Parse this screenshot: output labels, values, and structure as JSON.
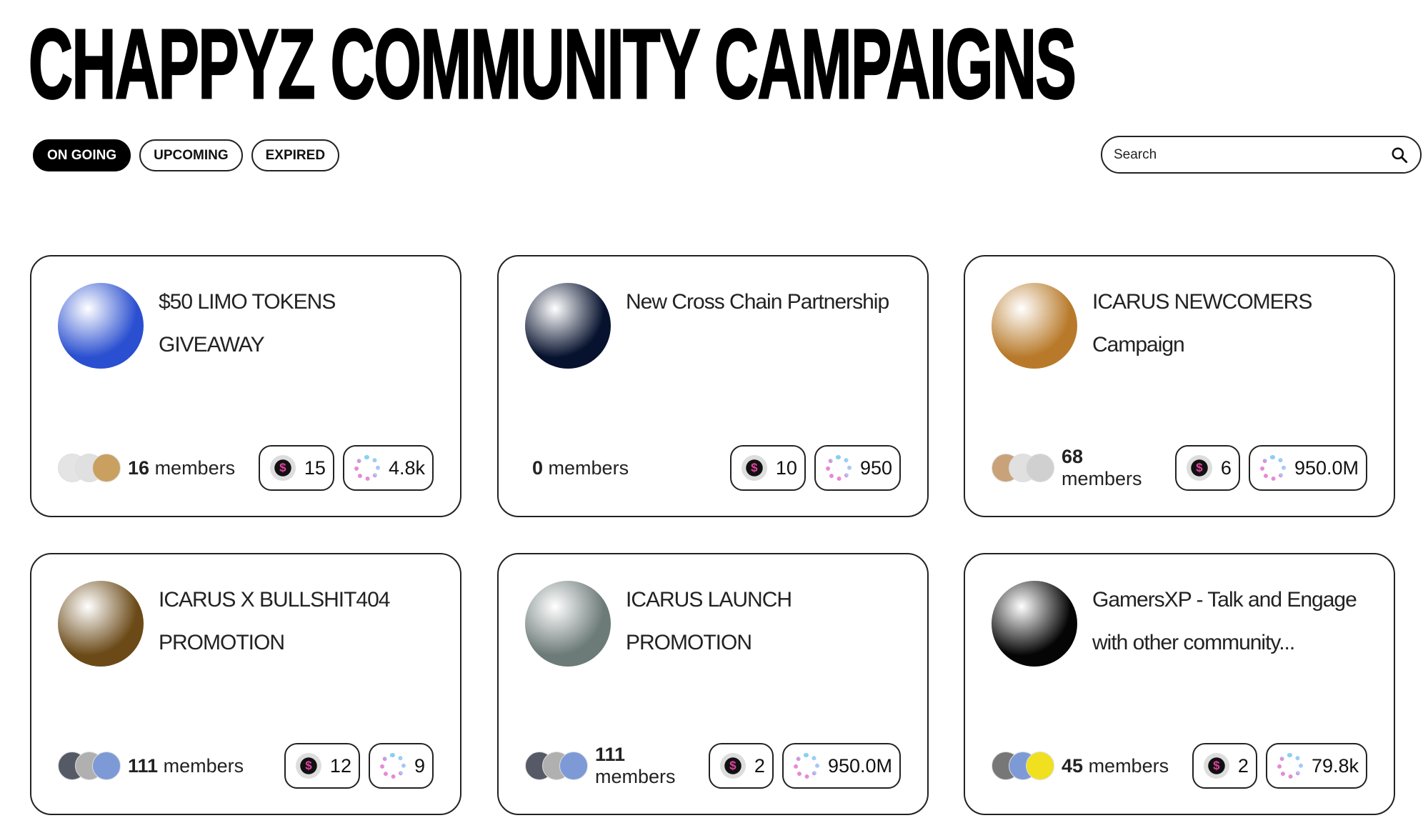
{
  "page": {
    "title": "CHAPPYZ COMMUNITY CAMPAIGNS"
  },
  "tabs": [
    {
      "label": "ON GOING",
      "active": true
    },
    {
      "label": "UPCOMING",
      "active": false
    },
    {
      "label": "EXPIRED",
      "active": false
    }
  ],
  "search": {
    "placeholder": "Search",
    "icon": "search-icon"
  },
  "colors": {
    "accent": "#000000",
    "border": "#222222"
  },
  "cards": [
    {
      "title": "$50 LIMO TOKENS GIVEAWAY",
      "members_count": "16",
      "members_label": "members",
      "points": "15",
      "xp": "4.8k",
      "avatar_color": "#2a4fd0",
      "member_avatars": [
        "#e4e4e4",
        "#e0e0e0",
        "#c9a060"
      ]
    },
    {
      "title": "New Cross Chain Partnership",
      "members_count": "0",
      "members_label": "members",
      "points": "10",
      "xp": "950",
      "avatar_color": "#07122e",
      "member_avatars": []
    },
    {
      "title": "ICARUS NEWCOMERS Campaign",
      "members_count": "68",
      "members_label": "members",
      "points": "6",
      "xp": "950.0M",
      "avatar_color": "#b87a2a",
      "member_avatars": [
        "#c9a27a",
        "#e0e0e0",
        "#d0d0d0"
      ]
    },
    {
      "title": "ICARUS X BULLSHIT404 PROMOTION",
      "members_count": "111",
      "members_label": "members",
      "points": "12",
      "xp": "9",
      "avatar_color": "#6b4a18",
      "member_avatars": [
        "#555a66",
        "#b0b0b0",
        "#7d9ad6"
      ]
    },
    {
      "title": "ICARUS LAUNCH PROMOTION",
      "members_count": "111",
      "members_label": "members",
      "points": "2",
      "xp": "950.0M",
      "avatar_color": "#6c7a78",
      "member_avatars": [
        "#555a66",
        "#b0b0b0",
        "#7d9ad6"
      ]
    },
    {
      "title": "GamersXP - Talk and Engage with other community...",
      "members_count": "45",
      "members_label": "members",
      "points": "2",
      "xp": "79.8k",
      "avatar_color": "#050505",
      "member_avatars": [
        "#777777",
        "#7d9ad6",
        "#f0e020"
      ]
    }
  ]
}
